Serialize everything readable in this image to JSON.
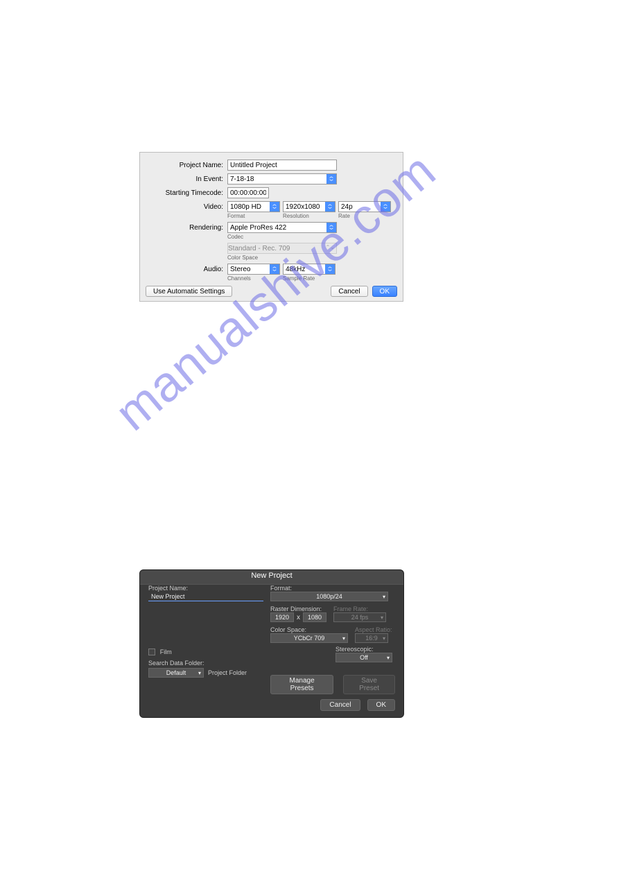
{
  "watermark": "manualshive.com",
  "dialog1": {
    "projectName": {
      "label": "Project Name:",
      "value": "Untitled Project"
    },
    "inEvent": {
      "label": "In Event:",
      "value": "7-18-18"
    },
    "startingTimecode": {
      "label": "Starting Timecode:",
      "value": "00:00:00:00"
    },
    "video": {
      "label": "Video:",
      "format": {
        "value": "1080p HD",
        "sublabel": "Format"
      },
      "resolution": {
        "value": "1920x1080",
        "sublabel": "Resolution"
      },
      "rate": {
        "value": "24p",
        "sublabel": "Rate"
      }
    },
    "rendering": {
      "label": "Rendering:",
      "codec": {
        "value": "Apple ProRes 422",
        "sublabel": "Codec"
      },
      "colorSpace": {
        "value": "Standard - Rec. 709",
        "sublabel": "Color Space"
      }
    },
    "audio": {
      "label": "Audio:",
      "channels": {
        "value": "Stereo",
        "sublabel": "Channels"
      },
      "sampleRate": {
        "value": "48kHz",
        "sublabel": "Sample Rate"
      }
    },
    "footer": {
      "autoSettings": "Use Automatic Settings",
      "cancel": "Cancel",
      "ok": "OK"
    }
  },
  "dialog2": {
    "title": "New Project",
    "projectName": {
      "label": "Project Name:",
      "value": "New Project"
    },
    "film": {
      "label": "Film"
    },
    "searchDataFolder": {
      "label": "Search Data Folder:",
      "value": "Default",
      "suffix": "Project Folder"
    },
    "format": {
      "label": "Format:",
      "value": "1080p/24"
    },
    "rasterDimension": {
      "label": "Raster Dimension:",
      "w": "1920",
      "x": "x",
      "h": "1080"
    },
    "frameRate": {
      "label": "Frame Rate:",
      "value": "24 fps"
    },
    "colorSpace": {
      "label": "Color Space:",
      "value": "YCbCr 709"
    },
    "aspectRatio": {
      "label": "Aspect Ratio:",
      "value": "16:9"
    },
    "stereoscopic": {
      "label": "Stereoscopic:",
      "value": "Off"
    },
    "buttons": {
      "managePresets": "Manage Presets",
      "savePreset": "Save Preset",
      "cancel": "Cancel",
      "ok": "OK"
    }
  }
}
